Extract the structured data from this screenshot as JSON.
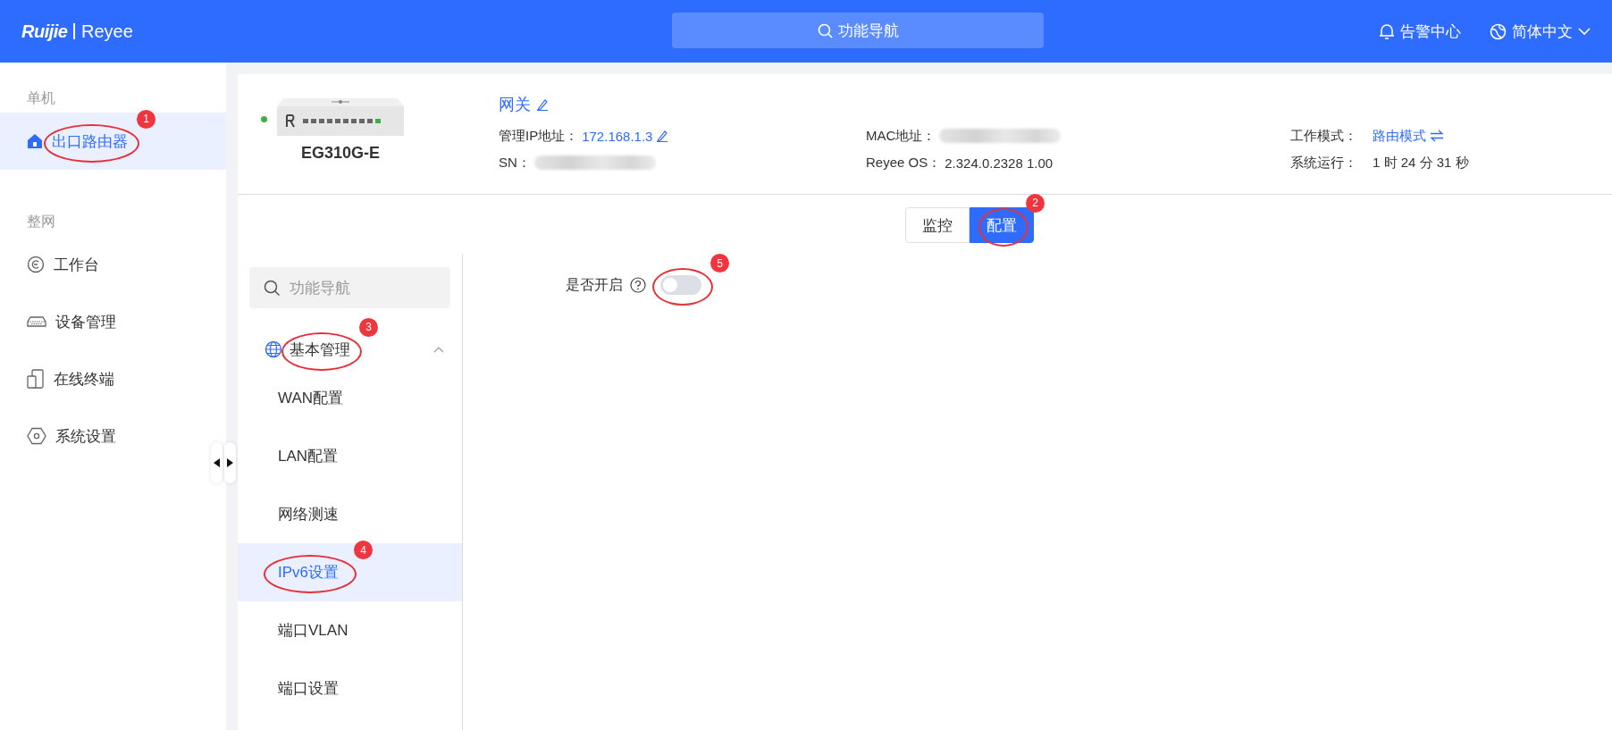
{
  "header": {
    "logo_brand": "Ruijie",
    "logo_product": "Reyee",
    "search": "功能导航",
    "alerts": "告警中心",
    "language": "简体中文"
  },
  "sidebar": {
    "sections": [
      {
        "title": "单机",
        "items": [
          {
            "label": "出口路由器",
            "selected": true,
            "annotation": "1"
          }
        ]
      },
      {
        "title": "整网",
        "items": [
          {
            "label": "工作台",
            "selected": false
          },
          {
            "label": "设备管理",
            "selected": false
          },
          {
            "label": "在线终端",
            "selected": false
          },
          {
            "label": "系统设置",
            "selected": false
          }
        ]
      }
    ]
  },
  "device": {
    "online": true,
    "model": "EG310G-E",
    "name": "网关",
    "fields": [
      {
        "label": "管理IP地址：",
        "value": "172.168.1.3",
        "kind": "editable"
      },
      {
        "label": "MAC地址：",
        "kind": "redacted"
      },
      {
        "label": "工作模式：",
        "value": "路由模式",
        "kind": "switchable"
      },
      {
        "label": "SN：",
        "kind": "redacted"
      },
      {
        "label": "Reyee OS：",
        "value": "2.324.0.2328 1.00",
        "kind": "plain"
      },
      {
        "label": "系统运行：",
        "value": "1 时 24 分 31 秒",
        "kind": "plain"
      }
    ]
  },
  "tabs": [
    {
      "label": "监控",
      "selected": false
    },
    {
      "label": "配置",
      "selected": true,
      "annotation": "2"
    }
  ],
  "subnav": {
    "placeholder": "功能导航",
    "groups": [
      {
        "label": "基本管理",
        "expanded": true,
        "annotation": "3",
        "children": [
          {
            "label": "WAN配置",
            "selected": false
          },
          {
            "label": "LAN配置",
            "selected": false
          },
          {
            "label": "网络测速",
            "selected": false
          },
          {
            "label": "IPv6设置",
            "selected": true,
            "annotation": "4"
          },
          {
            "label": "端口VLAN",
            "selected": false
          },
          {
            "label": "端口设置",
            "selected": false
          }
        ]
      }
    ]
  },
  "content": {
    "fields": [
      {
        "label": "是否开启",
        "kind": "toggle",
        "on": false,
        "annotation": "5"
      }
    ]
  }
}
